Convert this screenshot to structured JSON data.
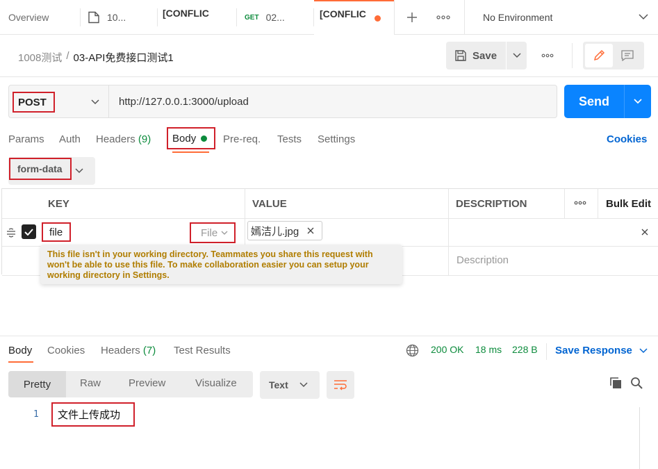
{
  "tabs": [
    {
      "label": "Overview"
    },
    {
      "label": "10..."
    },
    {
      "label": "[CONFLIC"
    },
    {
      "method": "GET",
      "label": "02..."
    },
    {
      "label": "[CONFLIC"
    }
  ],
  "environment": {
    "label": "No Environment"
  },
  "breadcrumb": {
    "collection": "1008测试",
    "separator": "/",
    "request": "03-API免费接口测试1"
  },
  "actions": {
    "save": "Save"
  },
  "request": {
    "method": "POST",
    "url": "http://127.0.0.1:3000/upload",
    "send": "Send"
  },
  "req_tabs": {
    "params": "Params",
    "auth": "Auth",
    "headers": "Headers",
    "headers_count": "(9)",
    "body": "Body",
    "prereq": "Pre-req.",
    "tests": "Tests",
    "settings": "Settings",
    "cookies": "Cookies"
  },
  "body_type": {
    "selected": "form-data"
  },
  "table": {
    "headers": {
      "key": "KEY",
      "value": "VALUE",
      "description": "DESCRIPTION",
      "bulk_edit": "Bulk Edit"
    },
    "row": {
      "key": "file",
      "type": "File",
      "value": "嫣洁儿.jpg"
    },
    "empty_row": {
      "description_placeholder": "Description"
    }
  },
  "warning": {
    "text": "This file isn't in your working directory. Teammates you share this request with won't be able to use this file. To make collaboration easier you can setup your working directory in Settings."
  },
  "response": {
    "tabs": {
      "body": "Body",
      "cookies": "Cookies",
      "headers": "Headers",
      "headers_count": "(7)",
      "test_results": "Test Results"
    },
    "status": "200 OK",
    "time": "18 ms",
    "size": "228 B",
    "save_response": "Save Response",
    "views": {
      "pretty": "Pretty",
      "raw": "Raw",
      "preview": "Preview",
      "visualize": "Visualize"
    },
    "format": "Text",
    "line_number": "1",
    "line_content": "文件上传成功"
  },
  "colors": {
    "accent_blue": "#0265d2",
    "send_blue": "#0a84ff",
    "orange": "#ff6c37",
    "green": "#0c8b3c",
    "warning_text": "#b07d00",
    "highlight_red": "#d0202a"
  }
}
